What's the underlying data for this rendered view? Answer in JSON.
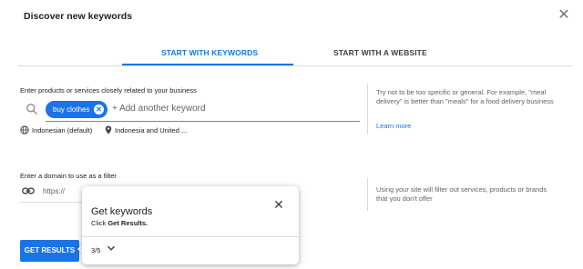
{
  "dialog": {
    "title": "Discover new keywords",
    "close_symbol": "✕"
  },
  "tabs": [
    {
      "label": "START WITH KEYWORDS",
      "active": true
    },
    {
      "label": "START WITH A WEBSITE",
      "active": false
    }
  ],
  "keywords_section": {
    "label": "Enter products or services closely related to your business",
    "chip": "buy clothes",
    "chip_remove_symbol": "✕",
    "add_placeholder": "+ Add another keyword",
    "language": "Indonesian (default)",
    "location": "Indonesia and United ...",
    "hint": "Try not to be too specific or general. For example, \"meal delivery\" is better than \"meals\" for a food delivery business",
    "learn_more": "Learn more"
  },
  "domain_section": {
    "label": "Enter a domain to use as a filter",
    "url_prefix": "https://",
    "hint": "Using your site will filter out services, products or brands that you don't offer"
  },
  "primary_button": {
    "label": "GET RESULTS"
  },
  "coach_popup": {
    "title": "Get keywords",
    "subtitle_prefix": "Click ",
    "subtitle_bold": "Get Results.",
    "step": "3/5",
    "close_symbol": "✕"
  },
  "colors": {
    "accent": "#1a73e8",
    "text": "#202124",
    "muted": "#5f6368",
    "divider": "#dadce0"
  },
  "icons": [
    "close-icon",
    "search-icon",
    "chip-remove-icon",
    "globe-icon",
    "location-pin-icon",
    "link-icon",
    "chevron-down-icon"
  ]
}
